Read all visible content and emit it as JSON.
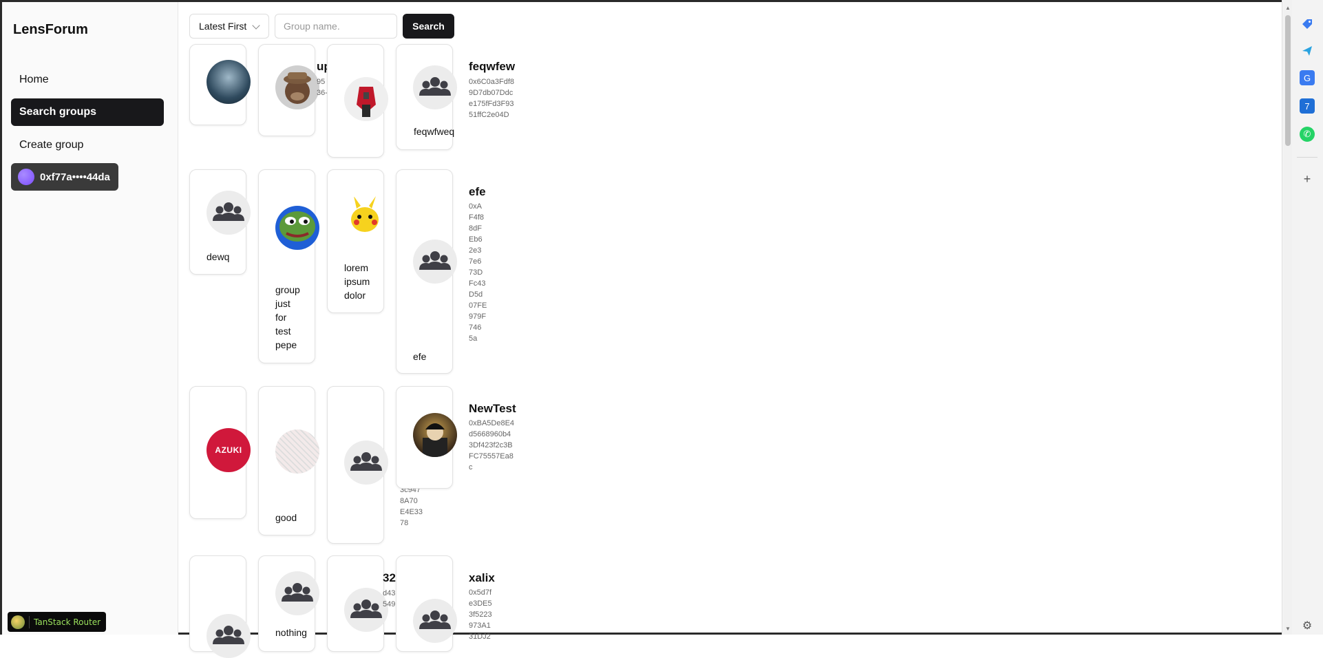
{
  "sidebar": {
    "brand": "LensForum",
    "items": [
      {
        "label": "Home"
      },
      {
        "label": "Search groups"
      },
      {
        "label": "Create group"
      }
    ],
    "wallet": "0xf77a••••44da"
  },
  "toolbar": {
    "sort_value": "Latest First",
    "search_placeholder": "Group name.",
    "search_label": "Search"
  },
  "groups": {
    "r1c2_title_fragment": "up",
    "r1c2_addr_fragment": "95\n36-",
    "r1c4_name": "feqwfweq",
    "r1c4_title": "feqwfew",
    "r1c4_addr": "0x6C0a3Fdf8\n9D7db07Ddc\ne175fFd3F93\n51ffC2e04D",
    "r2c1_name": "dewq",
    "r2c2_name": "group\njust\nfor\ntest\npepe",
    "r2c3_name": "lorem\nipsum\ndolor",
    "r2c4_name": "efe",
    "r2c4_title": "efe",
    "r2c4_addr": "0xA\nF4f8\n8dF\nEb6\n2e3\n7e6\n73D\nFc43\nD5d\n07FE\n979F\n746\n5a",
    "r3c1_logo_text": "AZUKI",
    "r3c2_name": "good",
    "r3c3_addr_fragment": "3c947\n8A70\nE4E33\n78",
    "r3c4_title": "NewTest",
    "r3c4_addr": "0xBA5De8E4\nd5668960b4\n3Df423f2c3B\nFC75557Ea8\nc",
    "r4c2_name": "nothing",
    "r4c3_title_fragment": "32",
    "r4c3_addr_fragment": "d43\n549",
    "r4c4_title": "xalix",
    "r4c4_addr": "0x5d7f\ne3DE5\n3f5223\n973A1\n31DJ2"
  },
  "devtools": {
    "label": "TanStack Router"
  },
  "colors": {
    "accent": "#18181b",
    "wallet_bg": "#3a3a3a",
    "azuki_red": "#d0183b"
  },
  "icons": [
    "group-icon",
    "chevron-down-icon",
    "tag-icon",
    "send-icon",
    "translate-icon",
    "calendar-icon",
    "whatsapp-icon",
    "plus-icon",
    "gear-icon"
  ]
}
